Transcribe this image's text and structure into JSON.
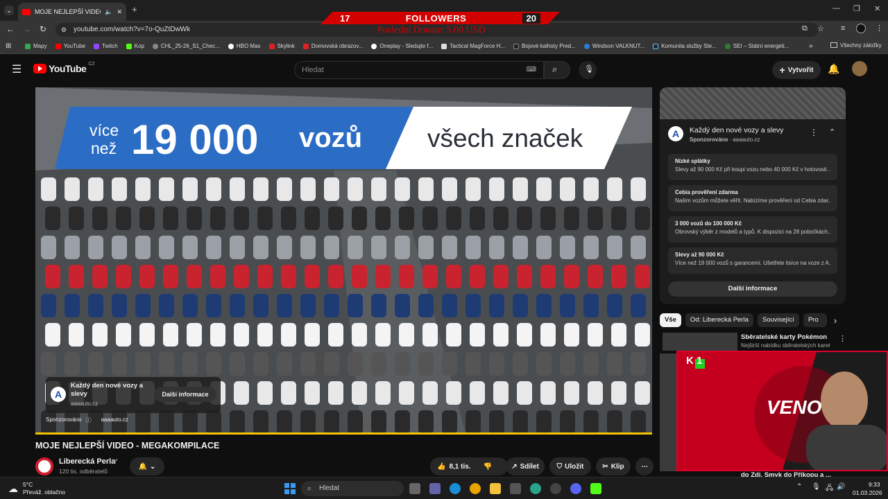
{
  "browser": {
    "tab_title": "MOJE NEJLEPŠÍ VIDEO - ME",
    "url": "youtube.com/watch?v=7o-QuZtDwWk",
    "bookmarks": [
      "Mapy",
      "YouTube",
      "Twitch",
      "Kop",
      "CHL_25-26_S1_Chec...",
      "HBO Max",
      "Skylink",
      "Domovská obrazov...",
      "Oneplay - Sledujte f...",
      "Tactical MagForce H...",
      "Bojové kalhoty Pred...",
      "Windson VALKNUT...",
      "Komunita služby Ste...",
      "SEI – Státní energeti..."
    ],
    "all_bookmarks": "Všechny záložky"
  },
  "overlay": {
    "left_num": "17",
    "label": "FOLLOWERS",
    "right_num": "20",
    "donate": "Poslední Donate: 5.00 USD"
  },
  "youtube": {
    "logo": "YouTube",
    "logo_country": "CZ",
    "search_placeholder": "Hledat",
    "create_label": "Vytvořit"
  },
  "player": {
    "banner_left_small1": "více",
    "banner_left_small2": "než",
    "banner_number": "19 000",
    "banner_word": "vozů",
    "banner_right": "všech značek",
    "ad_card_title": "Každý den nové vozy a slevy",
    "ad_card_domain": "aaaauto.cz",
    "ad_card_button": "Další informace",
    "sponsored": "Sponzorováno",
    "sponsored_domain": "aaaauto.cz"
  },
  "video": {
    "title": "MOJE NEJLEPŠÍ VIDEO - MEGAKOMPILACE",
    "channel": "Liberecká Perla",
    "subscribers": "120 tis. odběratelů",
    "likes": "8,1 tis.",
    "share": "Sdílet",
    "save": "Uložit",
    "clip": "Klip"
  },
  "sidebar_ad": {
    "title": "Každý den nové vozy a slevy",
    "sponsored": "Sponzorováno",
    "domain": "aaaauto.cz",
    "rows": [
      {
        "title": "Nízké splátky",
        "text": "Slevy až 90 000 Kč při koupi vozu nebo 40 000 Kč v hotovosti ..."
      },
      {
        "title": "Cebia prověření zdarma",
        "text": "Našim vozům můžete věřit. Nabízíme prověření od Cebia zdar..."
      },
      {
        "title": "3 000 vozů do 100 000 Kč",
        "text": "Obrovský výběr z modelů a typů. K dispozici na 28 pobočkách..."
      },
      {
        "title": "Slevy až 90 000 Kč",
        "text": "Více než 19 000 vozů s garancemi. Ušetřete tisíce na voze z A..."
      }
    ],
    "button": "Další informace"
  },
  "chips": [
    "Vše",
    "Od: Liberecká Perla",
    "Související",
    "Pro"
  ],
  "recommended": [
    {
      "title": "Sběratelské karty Pokémon",
      "sub": "Nejširší nabídku sběratelských karet"
    },
    {
      "title": "do Zdi. Smyk do Příkopu a ...",
      "sub": ""
    }
  ],
  "webcam": {
    "badge": "K 1",
    "text": "VENO"
  },
  "taskbar": {
    "temp": "5°C",
    "weather": "Převáž. oblačno",
    "search": "Hledat",
    "time": "9:33",
    "date": "01.03.2026"
  },
  "colors": {
    "accent_red": "#ff0000",
    "overlay_red": "#d30000",
    "progress": "#f7c500",
    "banner_blue": "#2b6cc4"
  }
}
